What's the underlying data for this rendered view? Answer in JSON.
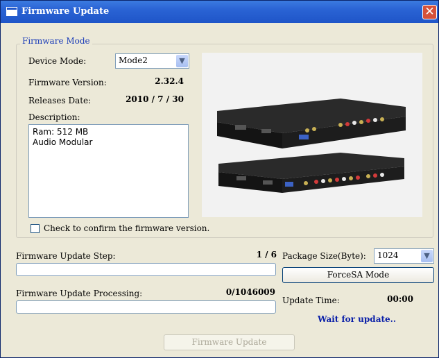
{
  "window": {
    "title": "Firmware Update"
  },
  "firmware_mode": {
    "legend": "Firmware Mode",
    "device_mode_label": "Device Mode:",
    "device_mode_value": "Mode2",
    "firmware_version_label": "Firmware Version:",
    "firmware_version_value": "2.32.4",
    "releases_date_label": "Releases Date:",
    "releases_date_value": "2010 / 7 / 30",
    "description_label": "Description:",
    "description_lines": [
      "Ram: 512 MB",
      "Audio Modular"
    ],
    "confirm_label": "Check to confirm the firmware version.",
    "confirm_checked": false
  },
  "update": {
    "step_label": "Firmware Update Step:",
    "step_value": "1 / 6",
    "step_progress": 0,
    "processing_label": "Firmware Update Processing:",
    "processing_value": "0/1046009",
    "processing_progress": 0,
    "package_size_label": "Package Size(Byte):",
    "package_size_value": "1024",
    "forcesa_label": "ForceSA Mode",
    "update_time_label": "Update Time:",
    "update_time_value": "00:00",
    "status_text": "Wait for update..",
    "status_color": "#0a1fa8",
    "button_label": "Firmware Update"
  },
  "icons": {
    "close": "close-icon",
    "app": "window-app-icon",
    "dropdown": "chevron-down-icon"
  }
}
